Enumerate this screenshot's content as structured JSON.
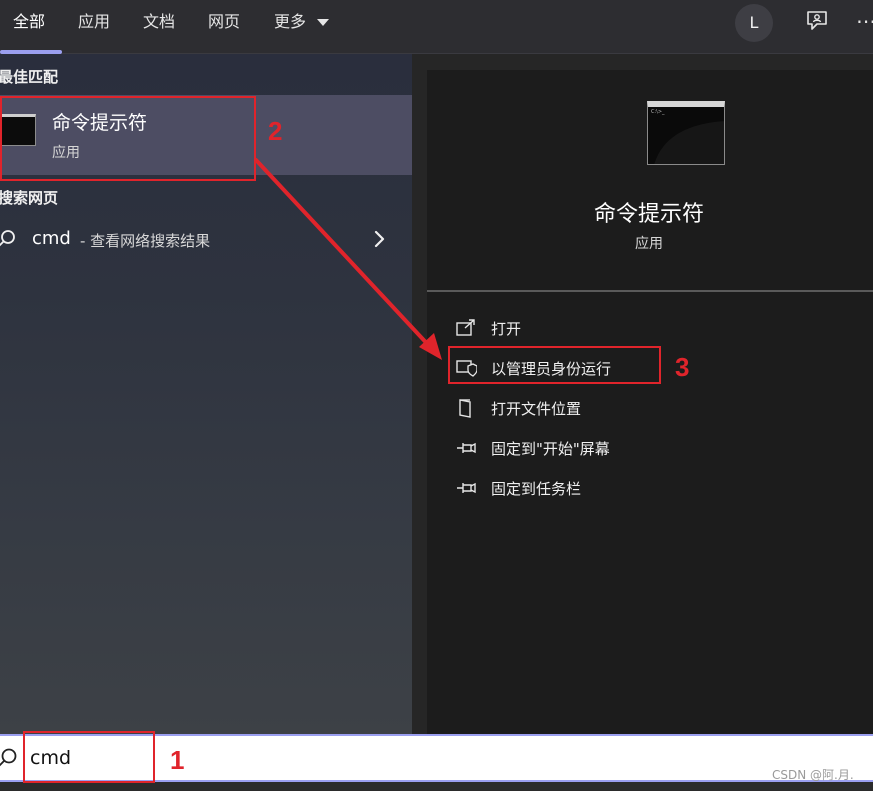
{
  "tabs": [
    {
      "label": "全部"
    },
    {
      "label": "应用"
    },
    {
      "label": "文档"
    },
    {
      "label": "网页"
    },
    {
      "label": "更多"
    }
  ],
  "header": {
    "avatar_letter": "L",
    "feedback_icon": "feedback-icon",
    "more_options_icon": "ellipsis-icon"
  },
  "best_match": {
    "section_title": "最佳匹配",
    "app_name": "命令提示符",
    "app_type": "应用",
    "icon": "command-prompt-icon"
  },
  "web_search": {
    "section_title": "搜索网页",
    "query": "cmd",
    "description": "- 查看网络搜索结果",
    "icon": "search-icon",
    "arrow_icon": "chevron-right-icon"
  },
  "preview": {
    "app_name": "命令提示符",
    "app_type": "应用",
    "thumb_text": "C:\\>_",
    "actions": [
      {
        "label": "打开",
        "icon": "open-icon"
      },
      {
        "label": "以管理员身份运行",
        "icon": "shield-icon"
      },
      {
        "label": "打开文件位置",
        "icon": "folder-icon"
      },
      {
        "label": "固定到\"开始\"屏幕",
        "icon": "pin-icon"
      },
      {
        "label": "固定到任务栏",
        "icon": "pin-icon"
      }
    ]
  },
  "search": {
    "value": "cmd"
  },
  "annotations": {
    "step1": "1",
    "step2": "2",
    "step3": "3",
    "color": "#e0242b"
  },
  "watermark": "CSDN @阿.月.",
  "colors": {
    "accent": "#9b9ff0",
    "selected_item": "#4d4d63",
    "preview_bg": "#1c1c1c"
  }
}
